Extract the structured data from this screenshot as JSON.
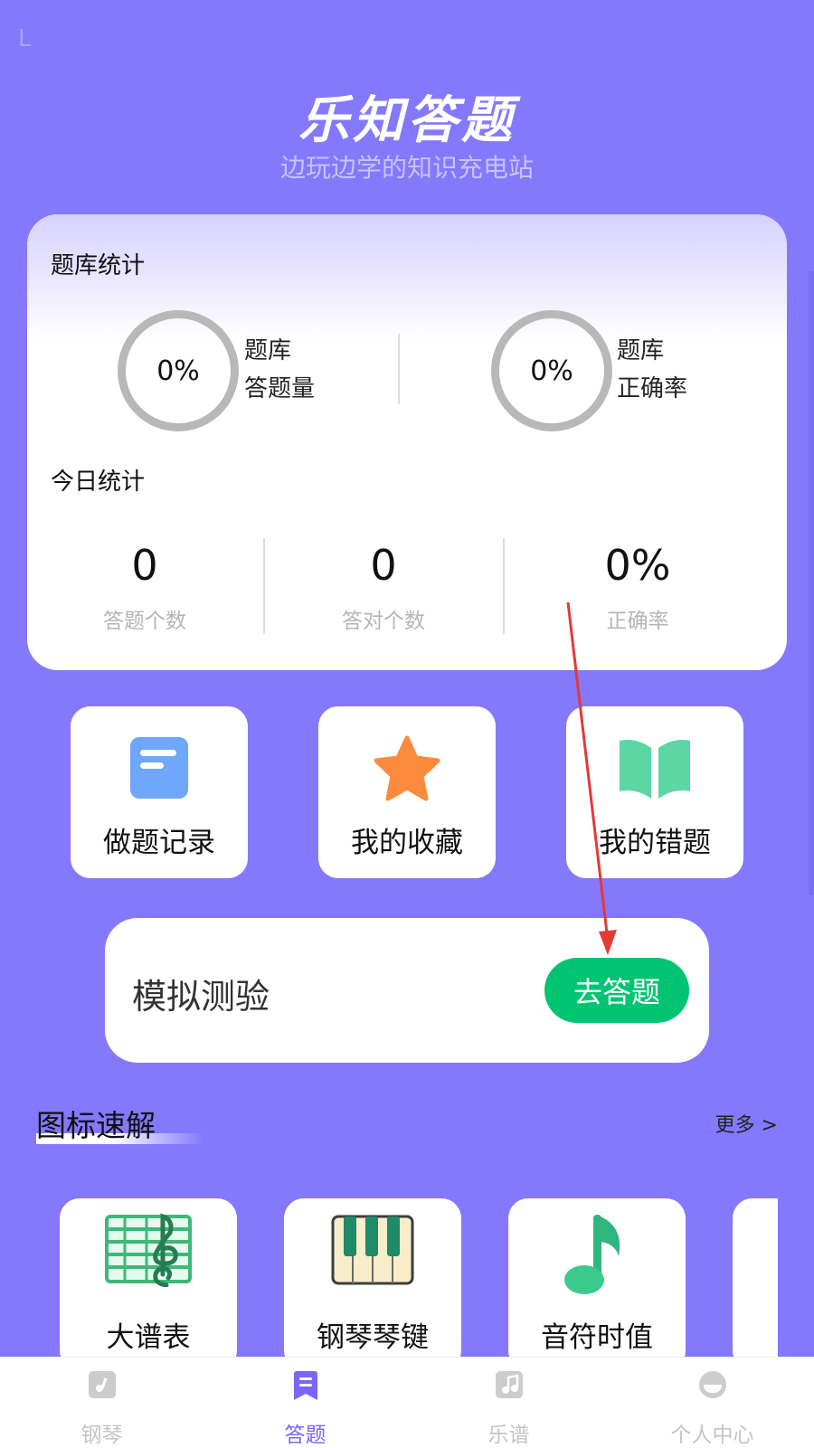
{
  "status": {
    "left_glyph": "L"
  },
  "header": {
    "title": "乐知答题",
    "subtitle": "边玩边学的知识充电站"
  },
  "bank_stats": {
    "title": "题库统计",
    "items": [
      {
        "value": "0%",
        "label_line1": "题库",
        "label_line2": "答题量"
      },
      {
        "value": "0%",
        "label_line1": "题库",
        "label_line2": "正确率"
      }
    ]
  },
  "today_stats": {
    "title": "今日统计",
    "items": [
      {
        "value": "0",
        "label": "答题个数"
      },
      {
        "value": "0",
        "label": "答对个数"
      },
      {
        "value": "0%",
        "label": "正确率"
      }
    ]
  },
  "quick_tiles": [
    {
      "label": "做题记录",
      "icon": "document-icon",
      "color": "#6ea7fb"
    },
    {
      "label": "我的收藏",
      "icon": "star-icon",
      "color": "#fe8a3d"
    },
    {
      "label": "我的错题",
      "icon": "open-book-icon",
      "color": "#5cd6a3"
    }
  ],
  "exam": {
    "title": "模拟测验",
    "button": "去答题",
    "button_color": "#00c471"
  },
  "icon_section": {
    "title": "图标速解",
    "more": "更多 >"
  },
  "icon_cards": [
    {
      "label": "大谱表",
      "icon": "grand-staff-icon"
    },
    {
      "label": "钢琴琴键",
      "icon": "piano-keys-icon"
    },
    {
      "label": "音符时值",
      "icon": "music-note-icon"
    }
  ],
  "tabs": [
    {
      "label": "钢琴",
      "icon": "piano-tab-icon",
      "active": false
    },
    {
      "label": "答题",
      "icon": "quiz-tab-icon",
      "active": true
    },
    {
      "label": "乐谱",
      "icon": "score-tab-icon",
      "active": false
    },
    {
      "label": "个人中心",
      "icon": "profile-tab-icon",
      "active": false
    }
  ],
  "colors": {
    "background": "#8479fd",
    "accent": "#7a67f5",
    "annotation_arrow": "#e53935"
  }
}
